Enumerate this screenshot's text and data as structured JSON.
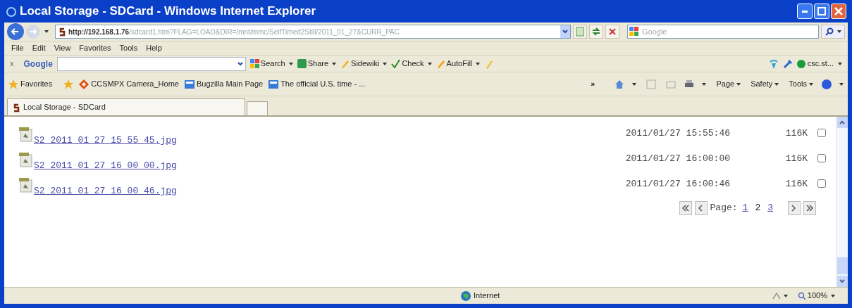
{
  "window": {
    "title": "Local Storage - SDCard - Windows Internet Explorer"
  },
  "address_bar": {
    "host": "http://192.168.1.76",
    "rest": "/sdcard1.htm?FLAG=LOAD&DIR=/mnt/mmc/SelfTimed2Still/2011_01_27&CURR_PAC"
  },
  "search_box": {
    "placeholder": "Google"
  },
  "menu": [
    "File",
    "Edit",
    "View",
    "Favorites",
    "Tools",
    "Help"
  ],
  "google_toolbar": {
    "close": "x",
    "logo": "Google",
    "items": [
      {
        "kind": "search",
        "label": "Search"
      },
      {
        "kind": "share",
        "label": "Share"
      },
      {
        "kind": "sidewiki",
        "label": "Sidewiki"
      },
      {
        "kind": "check",
        "label": "Check"
      },
      {
        "kind": "autofill",
        "label": "AutoFill"
      }
    ],
    "account": "csc.st..."
  },
  "favorites_bar": {
    "label": "Favorites",
    "links": [
      {
        "kind": "site",
        "label": "CCSMPX Camera_Home"
      },
      {
        "kind": "page",
        "label": "Bugzilla Main Page"
      },
      {
        "kind": "page",
        "label": "The official U.S. time - ..."
      }
    ],
    "overflow": "»"
  },
  "command_bar": [
    "Page",
    "Safety",
    "Tools"
  ],
  "tabs": [
    {
      "label": "Local Storage - SDCard",
      "selected": true
    }
  ],
  "files": [
    {
      "name": "S2_2011_01_27_15_55_45.jpg",
      "date": "2011/01/27 15:55:46",
      "size": "116K",
      "checked": false
    },
    {
      "name": "S2_2011_01_27_16_00_00.jpg",
      "date": "2011/01/27 16:00:00",
      "size": "116K",
      "checked": false
    },
    {
      "name": "S2_2011_01_27_16_00_46.jpg",
      "date": "2011/01/27 16:00:46",
      "size": "116K",
      "checked": false
    }
  ],
  "pager": {
    "label": "Page:",
    "pages": [
      {
        "label": "1",
        "selected": false
      },
      {
        "label": "2",
        "selected": true
      },
      {
        "label": "3",
        "selected": false
      }
    ]
  },
  "status_bar": {
    "zone": "Internet",
    "zoom": "100%"
  }
}
